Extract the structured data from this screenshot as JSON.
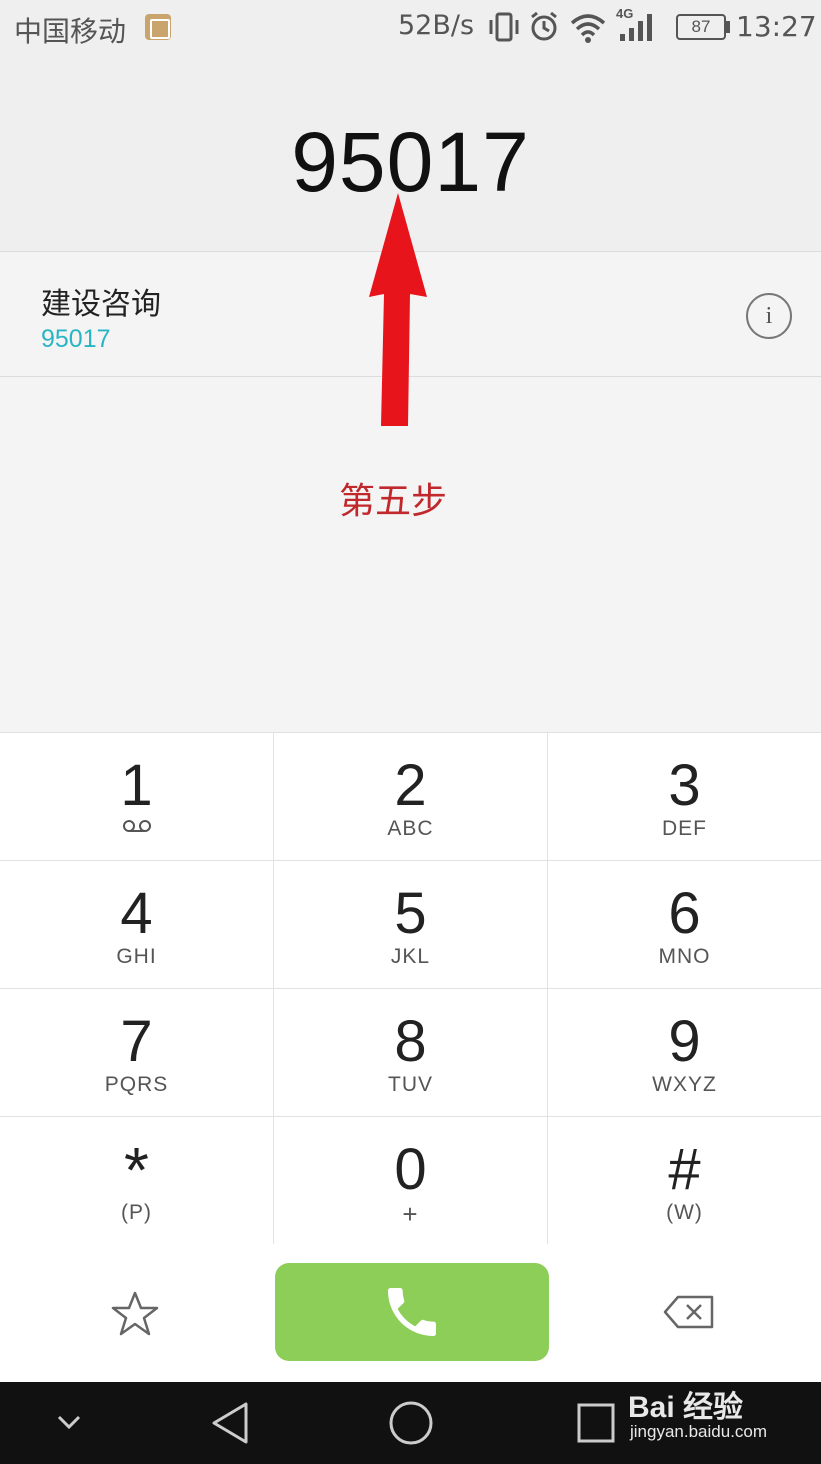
{
  "status_bar": {
    "carrier": "中国移动",
    "net_speed": "52B/s",
    "network": "4G",
    "battery": "87",
    "time": "13:27",
    "icons": [
      "gallery-icon",
      "vibrate-icon",
      "alarm-icon",
      "wifi-icon",
      "signal-icon",
      "battery-icon"
    ]
  },
  "dialer": {
    "number": "95017"
  },
  "contact_match": {
    "name": "建设咨询",
    "number": "95017",
    "info_label": "i"
  },
  "annotation": {
    "text": "第五步",
    "color": "#c0282c",
    "arrow_color": "#e8141b"
  },
  "keypad": {
    "keys": [
      {
        "digit": "1",
        "letters": "",
        "icon": "voicemail-icon"
      },
      {
        "digit": "2",
        "letters": "ABC"
      },
      {
        "digit": "3",
        "letters": "DEF"
      },
      {
        "digit": "4",
        "letters": "GHI"
      },
      {
        "digit": "5",
        "letters": "JKL"
      },
      {
        "digit": "6",
        "letters": "MNO"
      },
      {
        "digit": "7",
        "letters": "PQRS"
      },
      {
        "digit": "8",
        "letters": "TUV"
      },
      {
        "digit": "9",
        "letters": "WXYZ"
      },
      {
        "digit": "*",
        "letters": "(P)"
      },
      {
        "digit": "0",
        "letters": "+"
      },
      {
        "digit": "#",
        "letters": "(W)"
      }
    ]
  },
  "actions": {
    "call_color": "#8cce58",
    "icons": [
      "star-icon",
      "phone-icon",
      "backspace-icon"
    ]
  },
  "watermark": {
    "brand": "Bai 经验",
    "url": "jingyan.baidu.com"
  },
  "colors": {
    "accent": "#2ab5c4",
    "background": "#f4f4f4"
  }
}
